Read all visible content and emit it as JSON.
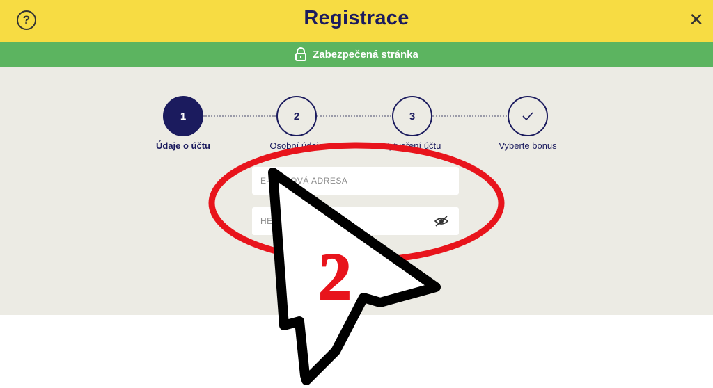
{
  "header": {
    "title": "Registrace",
    "help_icon": "?",
    "close_icon": "✕"
  },
  "secure_banner": {
    "text": "Zabezpečená stránka",
    "icon": "lock-icon"
  },
  "steps": [
    {
      "number": "1",
      "label": "Údaje o účtu",
      "active": true
    },
    {
      "number": "2",
      "label": "Osobní údaje",
      "active": false
    },
    {
      "number": "3",
      "label": "Vytvoření účtu",
      "active": false
    },
    {
      "number": "",
      "label": "Vyberte bonus",
      "active": false,
      "icon": "checkmark-icon"
    }
  ],
  "form": {
    "email_placeholder": "E-MAILOVÁ ADRESA",
    "password_placeholder": "HESLO",
    "password_toggle_icon": "eye-slash-icon"
  },
  "annotation": {
    "step_number": "2",
    "colors": {
      "ellipse": "#e8141c",
      "number": "#e8141c",
      "cursor_fill": "#ffffff",
      "cursor_stroke": "#000000"
    }
  },
  "colors": {
    "topbar": "#f7dc43",
    "secure_bar": "#5cb460",
    "navy": "#1b1b5e",
    "content_bg": "#ecebe4"
  }
}
